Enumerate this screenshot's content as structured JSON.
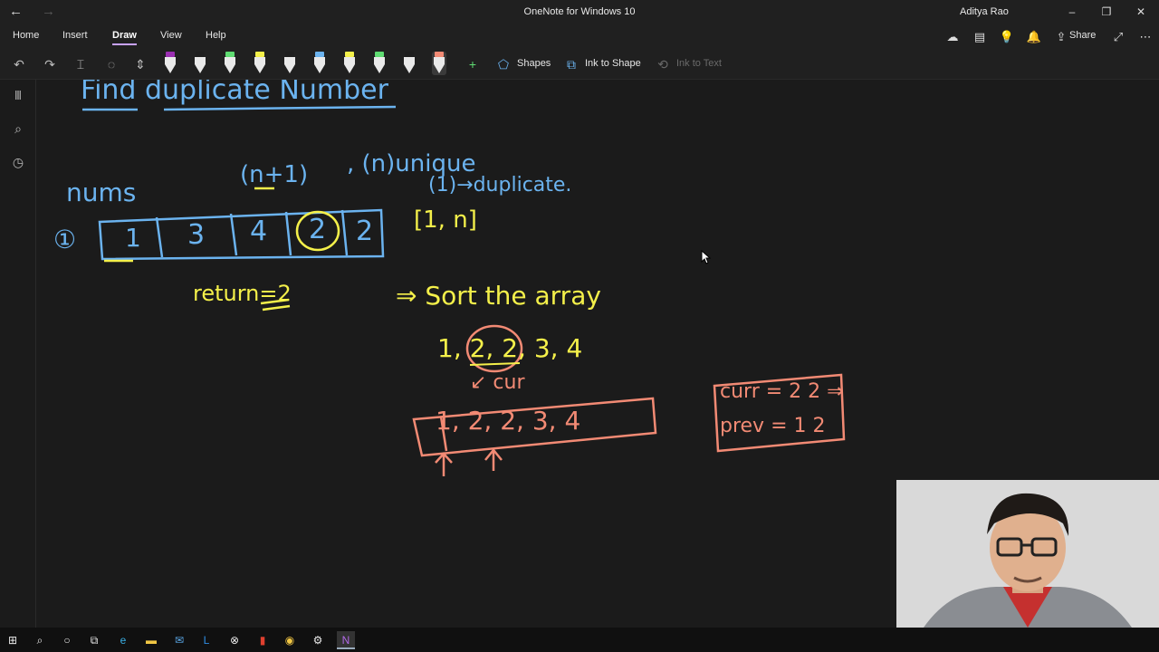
{
  "window": {
    "title": "OneNote for Windows 10",
    "user": "Aditya Rao"
  },
  "tabs": [
    "Home",
    "Insert",
    "Draw",
    "View",
    "Help"
  ],
  "active_tab": "Draw",
  "ribbon": {
    "share_label": "Share"
  },
  "toolbar": {
    "shapes_label": "Shapes",
    "ink_to_shape_label": "Ink to Shape",
    "ink_to_text_label": "Ink to Text",
    "pens": [
      {
        "color": "#9b2fb2"
      },
      {
        "color": "#1e1e1e"
      },
      {
        "color": "#5fdc72"
      },
      {
        "color": "#f4f04a"
      },
      {
        "color": "#1e1e1e"
      },
      {
        "color": "#6bb3ef"
      },
      {
        "color": "#f4f04a"
      },
      {
        "color": "#5fdc72"
      },
      {
        "color": "#1e1e1e"
      },
      {
        "color": "#f28a74"
      }
    ]
  },
  "notes": {
    "title": "Find duplicate Number",
    "nums_label": "nums",
    "n_plus_1": "(n+1)",
    "n_unique": ", (n)unique",
    "one_duplicate": "(1)→duplicate.",
    "example_number": "①",
    "array": [
      "1",
      "3",
      "4",
      "2",
      "2"
    ],
    "range": "[1, n]",
    "return_line": "return=2",
    "sort_line": "⇒ Sort the array",
    "sorted": "1, 2, 2, 3, 4",
    "cur_label": "↙ cur",
    "sorted_array": "1, 2, 2, 3, 4",
    "curr_box_line1": "curr = 2  2 ⇒",
    "curr_box_line2": "prev = 1  2"
  },
  "accent_colors": {
    "blue_ink": "#6bb3ef",
    "yellow_ink": "#f4f04a",
    "orange_ink": "#f28a74"
  }
}
